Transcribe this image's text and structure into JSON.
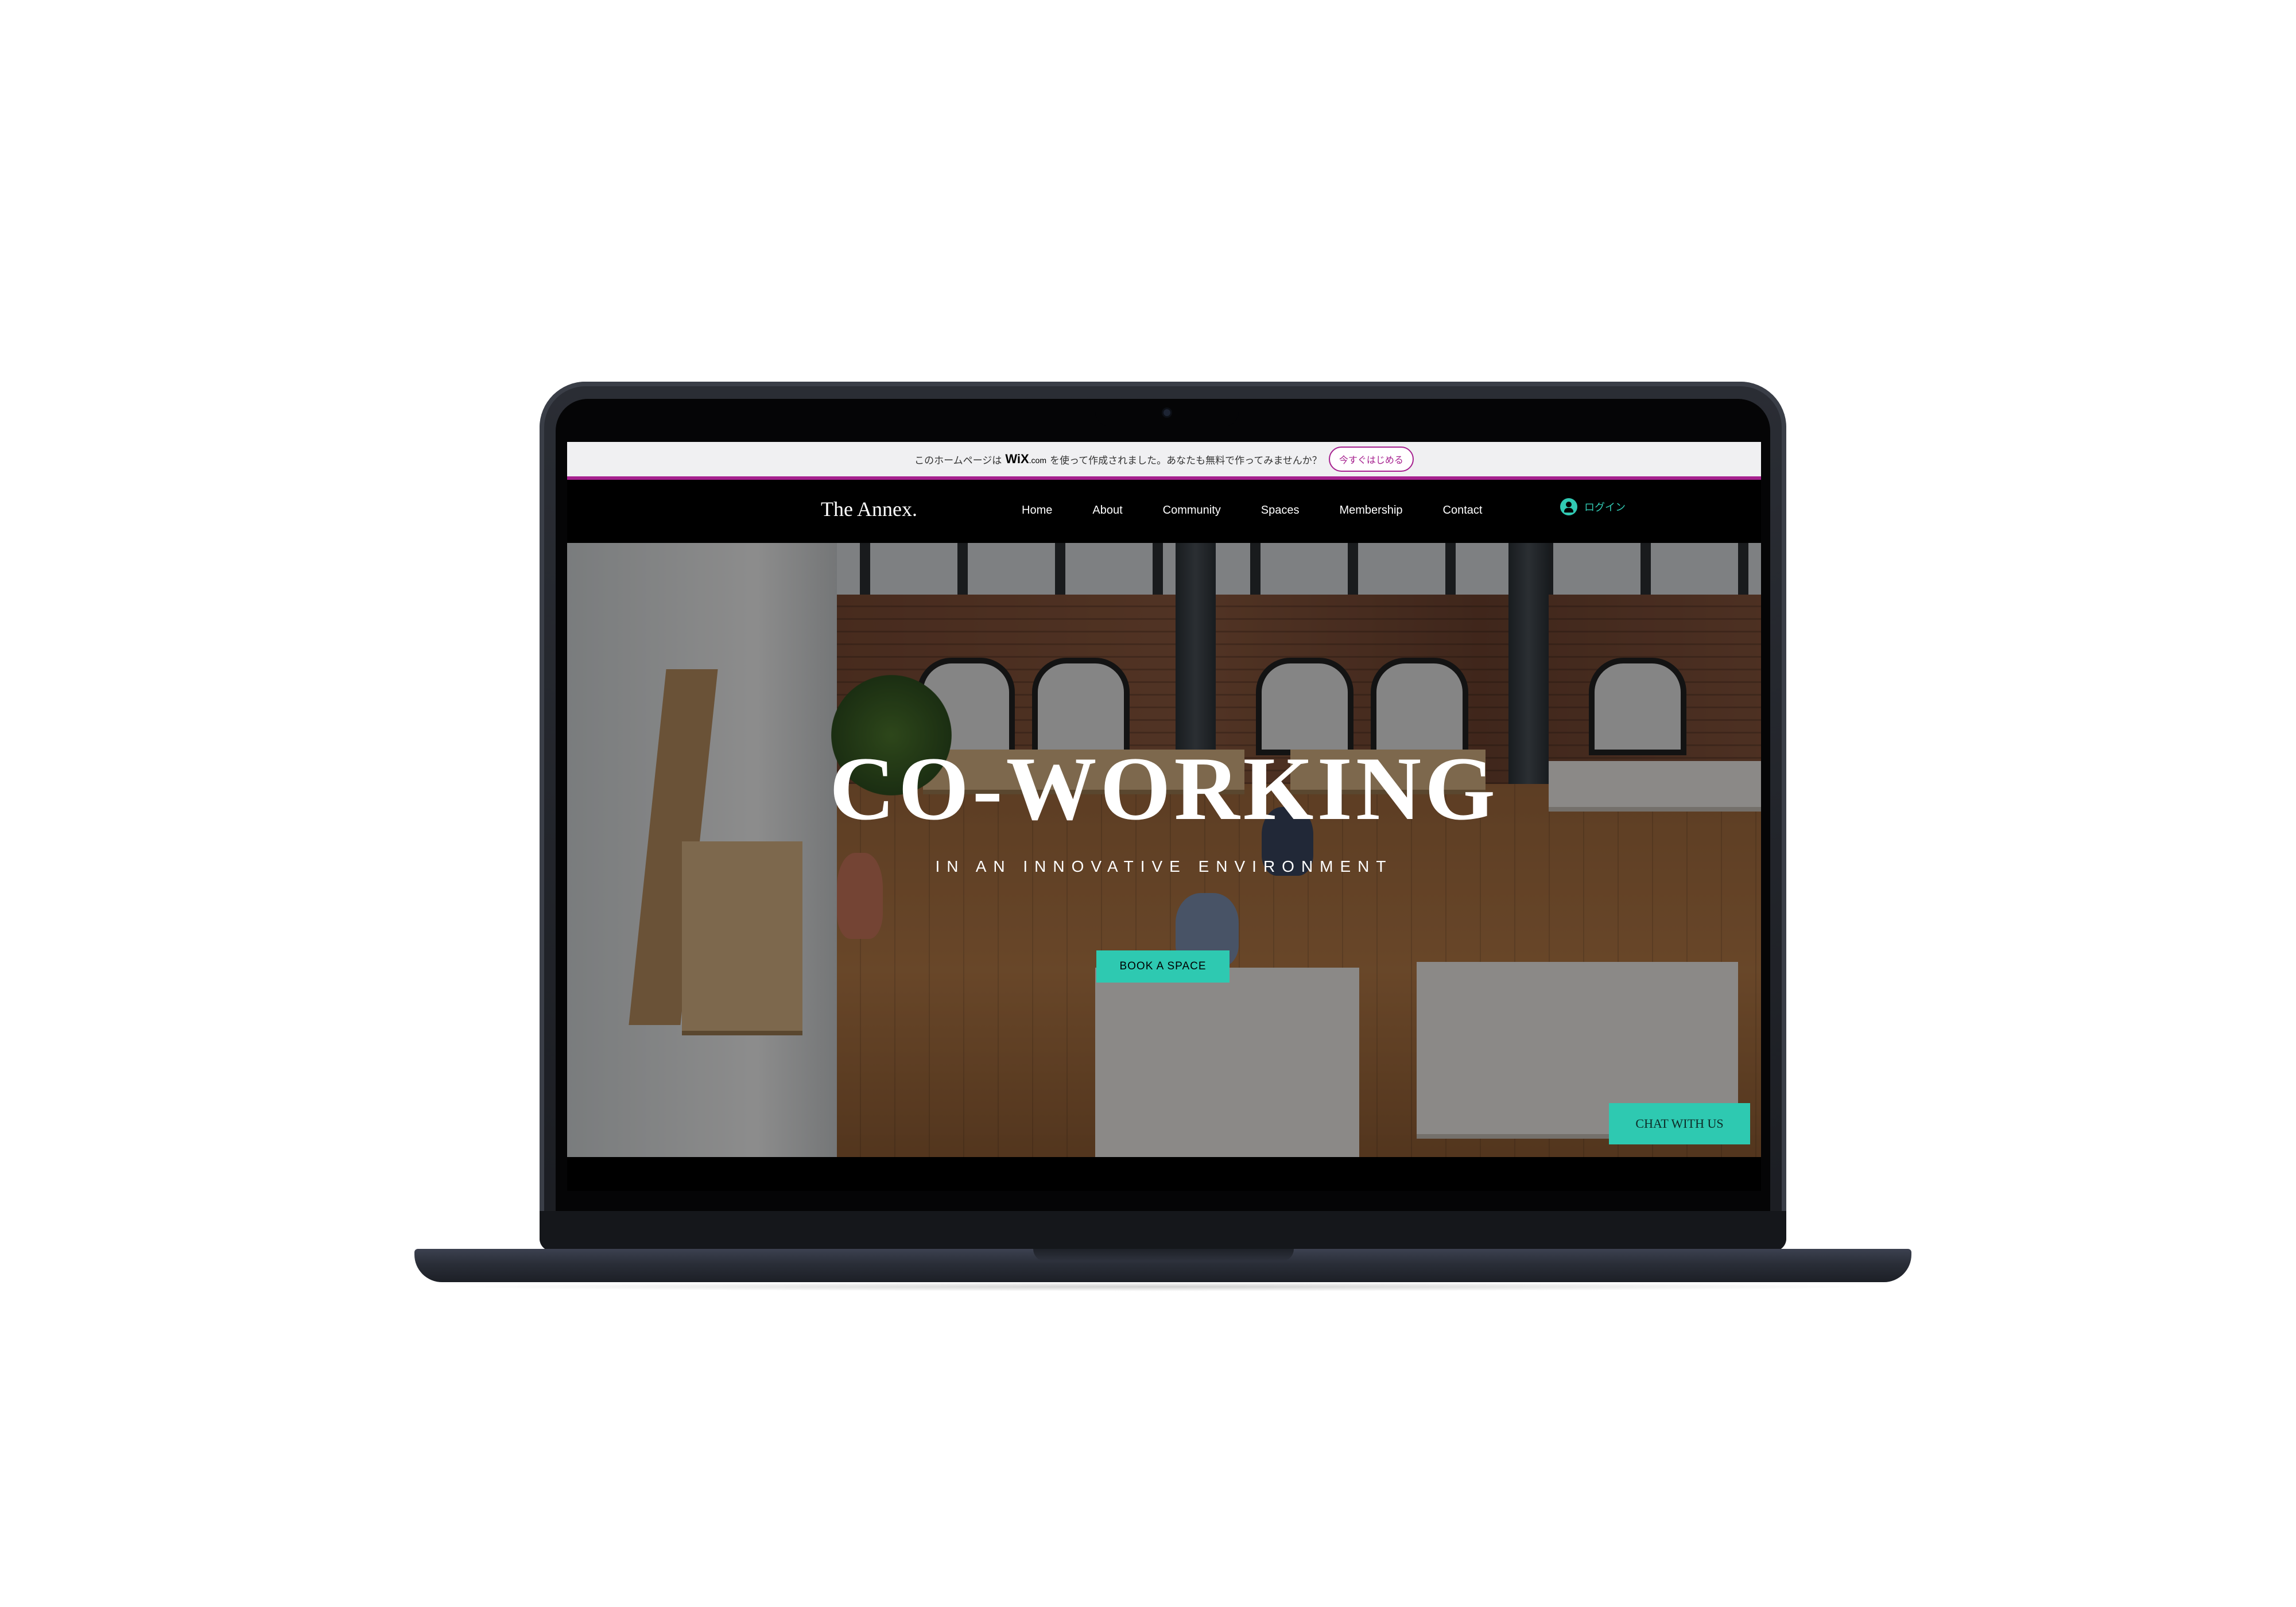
{
  "wix_banner": {
    "text_before": "このホームページは",
    "logo": "WiX",
    "logo_suffix": ".com",
    "text_after": "を使って作成されました。あなたも無料で作ってみませんか？",
    "cta_label": "今すぐはじめる"
  },
  "header": {
    "brand": "The Annex.",
    "nav": [
      "Home",
      "About",
      "Community",
      "Spaces",
      "Membership",
      "Contact"
    ],
    "login_label": "ログイン"
  },
  "hero": {
    "title": "CO-WORKING",
    "subtitle": "IN AN INNOVATIVE ENVIRONMENT",
    "book_button": "BOOK A SPACE"
  },
  "chat_button": "CHAT WITH US",
  "colors": {
    "accent": "#2ec9b1",
    "wix_brand": "#a6218f",
    "nav_bg": "#000000"
  },
  "icons": {
    "login": "avatar-icon",
    "camera": "camera"
  }
}
